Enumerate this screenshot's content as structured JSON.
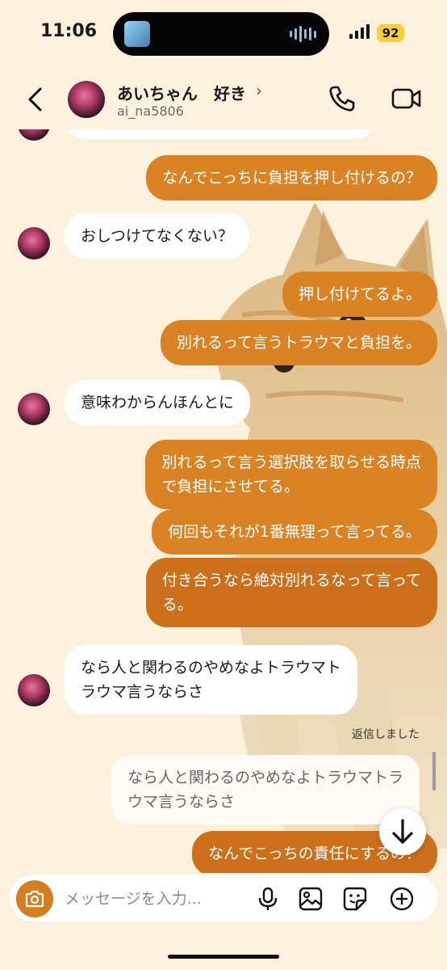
{
  "status_bar": {
    "time": "11:06",
    "battery": "92"
  },
  "header": {
    "name": "あいちゃん　好き",
    "chevron": "›",
    "handle": "ai_na5806"
  },
  "messages": [
    {
      "side": "out",
      "text": "なんでこっちに負担を押し付けるの？"
    },
    {
      "side": "in",
      "text": "おしつけてなくない？"
    },
    {
      "side": "out",
      "text": "押し付けてるよ。"
    },
    {
      "side": "out",
      "text": "別れるって言うトラウマと負担を。"
    },
    {
      "side": "in",
      "text": "意味わからんほんとに"
    },
    {
      "side": "out",
      "text": "別れるって言う選択肢を取らせる時点\nで負担にさせてる。"
    },
    {
      "side": "out",
      "text": "何回もそれが1番無理って言ってる。"
    },
    {
      "side": "out",
      "text": "付き合うなら絶対別れるなって言って\nる。"
    },
    {
      "side": "in",
      "text": "なら人と関わるのやめなよトラウマト\nラウマ言うならさ"
    },
    {
      "side": "out",
      "text": "なんでこっちの責任にするの？"
    }
  ],
  "reply": {
    "label": "返信しました",
    "quoted_text": "なら人と関わるのやめなよトラウマトラ\nウマ言うならさ"
  },
  "composer": {
    "placeholder": "メッセージを入力..."
  },
  "colors": {
    "outgoing_bubble": "#d98325",
    "background": "#fbf1dc",
    "incoming_bubble": "#ffffff"
  }
}
